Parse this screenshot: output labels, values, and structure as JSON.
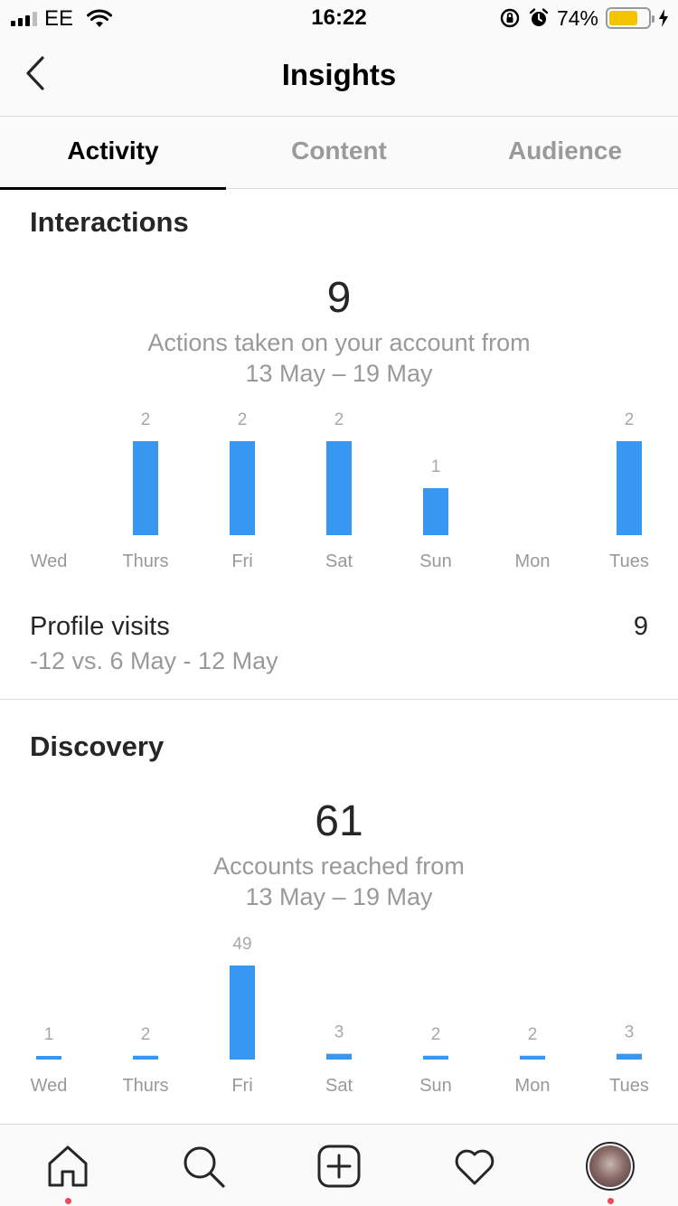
{
  "status_bar": {
    "carrier": "EE",
    "time": "16:22",
    "battery_percent": "74%",
    "battery_level": 0.74,
    "battery_color": "#f5c400"
  },
  "header": {
    "back_icon": "chevron-left-icon",
    "title": "Insights"
  },
  "tabs": [
    {
      "label": "Activity",
      "active": true
    },
    {
      "label": "Content",
      "active": false
    },
    {
      "label": "Audience",
      "active": false
    }
  ],
  "interactions": {
    "title": "Interactions",
    "total": "9",
    "caption_line1": "Actions taken on your account from",
    "caption_line2": "13 May – 19 May"
  },
  "profile_visits": {
    "label": "Profile visits",
    "value": "9",
    "comparison": "-12 vs. 6 May - 12 May"
  },
  "discovery": {
    "title": "Discovery",
    "total": "61",
    "caption_line1": "Accounts reached from",
    "caption_line2": "13 May – 19 May"
  },
  "chart_data": [
    {
      "type": "bar",
      "categories": [
        "Wed",
        "Thurs",
        "Fri",
        "Sat",
        "Sun",
        "Mon",
        "Tues"
      ],
      "values": [
        0,
        2,
        2,
        2,
        1,
        0,
        2
      ],
      "value_labels": [
        "",
        "2",
        "2",
        "2",
        "1",
        "",
        "2"
      ],
      "ylim": [
        0,
        2
      ],
      "color": "#3897f0"
    },
    {
      "type": "bar",
      "categories": [
        "Wed",
        "Thurs",
        "Fri",
        "Sat",
        "Sun",
        "Mon",
        "Tues"
      ],
      "values": [
        1,
        2,
        49,
        3,
        2,
        2,
        3
      ],
      "value_labels": [
        "1",
        "2",
        "49",
        "3",
        "2",
        "2",
        "3"
      ],
      "ylim": [
        0,
        49
      ],
      "color": "#3897f0"
    }
  ],
  "bottom_nav": [
    {
      "icon": "home-icon",
      "has_dot": true
    },
    {
      "icon": "search-icon",
      "has_dot": false
    },
    {
      "icon": "add-post-icon",
      "has_dot": false
    },
    {
      "icon": "heart-icon",
      "has_dot": false
    },
    {
      "icon": "profile-avatar-icon",
      "has_dot": true
    }
  ]
}
